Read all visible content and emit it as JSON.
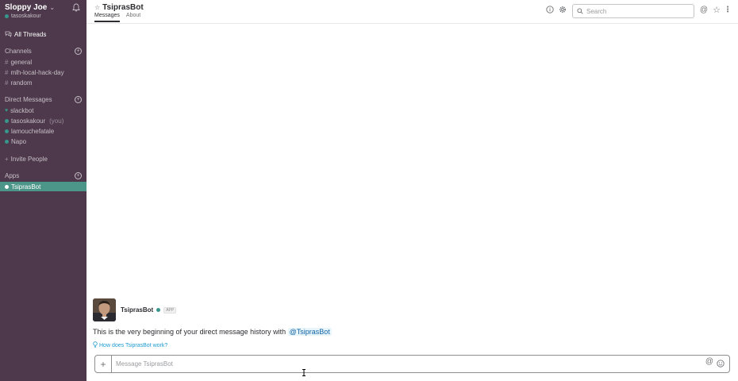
{
  "team": {
    "name": "Sloppy Joe",
    "chevron": "⌄",
    "user": "tasoskakour"
  },
  "sidebar": {
    "all_threads": "All Threads",
    "channels_header": "Channels",
    "channels": [
      {
        "label": "general"
      },
      {
        "label": "mlh-local-hack-day"
      },
      {
        "label": "random"
      }
    ],
    "dm_header": "Direct Messages",
    "dms": [
      {
        "label": "slackbot"
      },
      {
        "label": "tasoskakour",
        "suffix": "(you)"
      },
      {
        "label": "lamouchefatale"
      },
      {
        "label": "Napo"
      }
    ],
    "invite": "Invite People",
    "apps_header": "Apps",
    "apps": [
      {
        "label": "TsiprasBot"
      }
    ]
  },
  "header": {
    "title": "TsiprasBot",
    "tabs": [
      "Messages",
      "About"
    ],
    "search_placeholder": "Search"
  },
  "messages": {
    "bot_name": "TsiprasBot",
    "badge": "APP",
    "intro_text": "This is the very beginning of your direct message history with",
    "mention": "@TsiprasBot",
    "help_link": "How does TsiprasBot work?"
  },
  "composer": {
    "placeholder": "Message TsiprasBot"
  },
  "colors": {
    "sidebar_bg": "#4d394b",
    "active_item": "#4c9689",
    "presence": "#38978d",
    "link": "#1d9bd1"
  }
}
